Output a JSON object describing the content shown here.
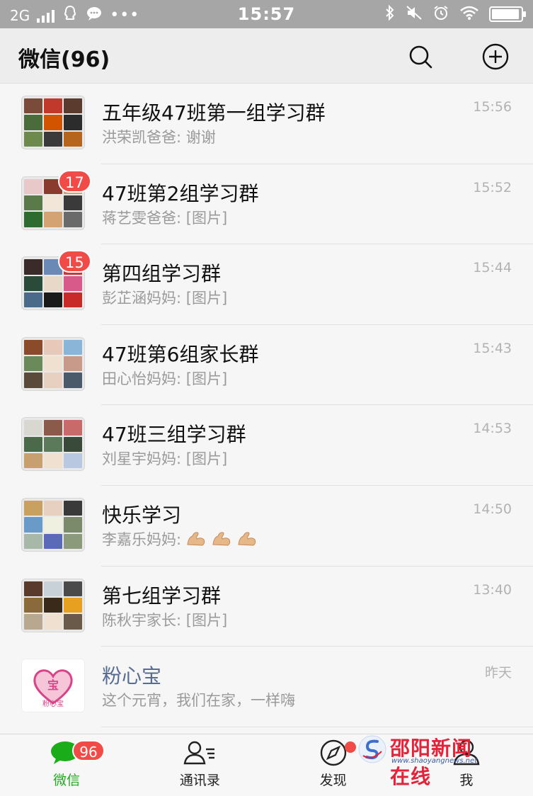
{
  "status_bar": {
    "network": "2G",
    "time": "15:57",
    "battery_level": 0.95
  },
  "header": {
    "title": "微信(96)",
    "search_icon": "search-icon",
    "add_icon": "plus-circle-icon"
  },
  "chats": [
    {
      "name": "五年级47班第一组学习群",
      "preview": "洪荣凯爸爸: 谢谢",
      "time": "15:56",
      "unread": "",
      "avatar_colors": [
        "#7a4a3a",
        "#c0392b",
        "#5a3b2e",
        "#4a6b3a",
        "#d35400",
        "#2c2c2c",
        "#6d8a4c",
        "#3a3a3a",
        "#b5651d"
      ]
    },
    {
      "name": "47班第2组学习群",
      "preview": "蒋艺雯爸爸: [图片]",
      "time": "15:52",
      "unread": "17",
      "avatar_colors": [
        "#e8c8c8",
        "#8b3a2e",
        "#c9a27a",
        "#5a7a4a",
        "#f2e6d8",
        "#3a3a3a",
        "#2e6b2e",
        "#d4a373",
        "#6a6a6a"
      ]
    },
    {
      "name": "第四组学习群",
      "preview": "彭芷涵妈妈: [图片]",
      "time": "15:44",
      "unread": "15",
      "avatar_colors": [
        "#3a2a2a",
        "#6a8ab5",
        "#c43a3a",
        "#2a4a3a",
        "#e8d8c8",
        "#d85a8a",
        "#4a6a8a",
        "#1a1a1a",
        "#c82a2a"
      ]
    },
    {
      "name": "47班第6组家长群",
      "preview": "田心怡妈妈: [图片]",
      "time": "15:43",
      "unread": "",
      "avatar_colors": [
        "#8b4a2a",
        "#e8c8b8",
        "#8ab5d8",
        "#6a8a5a",
        "#f0e0d0",
        "#c89a8a",
        "#5a4a3a",
        "#e8d0c0",
        "#4a5a6a"
      ]
    },
    {
      "name": "47班三组学习群",
      "preview": "刘星宇妈妈: [图片]",
      "time": "14:53",
      "unread": "",
      "avatar_colors": [
        "#d8d8d0",
        "#8b5a4a",
        "#c86a6a",
        "#4a6a4a",
        "#5a7a5a",
        "#3a4a3a",
        "#c8a070",
        "#f0e0d0",
        "#b8c8e0"
      ]
    },
    {
      "name": "快乐学习",
      "preview": "李嘉乐妈妈: ",
      "time": "14:50",
      "unread": "",
      "emoji_count": 3,
      "avatar_colors": [
        "#c8a060",
        "#e8d0c0",
        "#3a3a3a",
        "#6a9ac8",
        "#f0f0e0",
        "#7a8a6a",
        "#a8b8a8",
        "#5a6ab8",
        "#8a9a7a"
      ]
    },
    {
      "name": "第七组学习群",
      "preview": "陈秋宇家长: [图片]",
      "time": "13:40",
      "unread": "",
      "avatar_colors": [
        "#5a3a2a",
        "#c8d0d8",
        "#4a4a4a",
        "#8a6a3a",
        "#3a2a1a",
        "#e8a020",
        "#b8a890",
        "#f0e0d0",
        "#6a5a4a"
      ]
    },
    {
      "name": "粉心宝",
      "preview": "这个元宵，我们在家，一样嗨",
      "time": "昨天",
      "unread": "",
      "official": true,
      "logo_text": "宝",
      "logo_caption": "粉心宝"
    }
  ],
  "tabs": [
    {
      "label": "微信",
      "icon": "chat-bubble-icon",
      "badge": "96",
      "active": true
    },
    {
      "label": "通讯录",
      "icon": "contacts-icon",
      "badge": "",
      "active": false
    },
    {
      "label": "发现",
      "icon": "compass-icon",
      "badge": "",
      "dot": true,
      "active": false
    },
    {
      "label": "我",
      "icon": "person-icon",
      "badge": "",
      "active": false
    }
  ],
  "watermark": {
    "title": "邵阳新闻在线",
    "url": "www.shaoyangnews.net"
  },
  "colors": {
    "accent_green": "#1aad19",
    "badge_red": "#f04b47",
    "official_name_blue": "#576b95"
  }
}
